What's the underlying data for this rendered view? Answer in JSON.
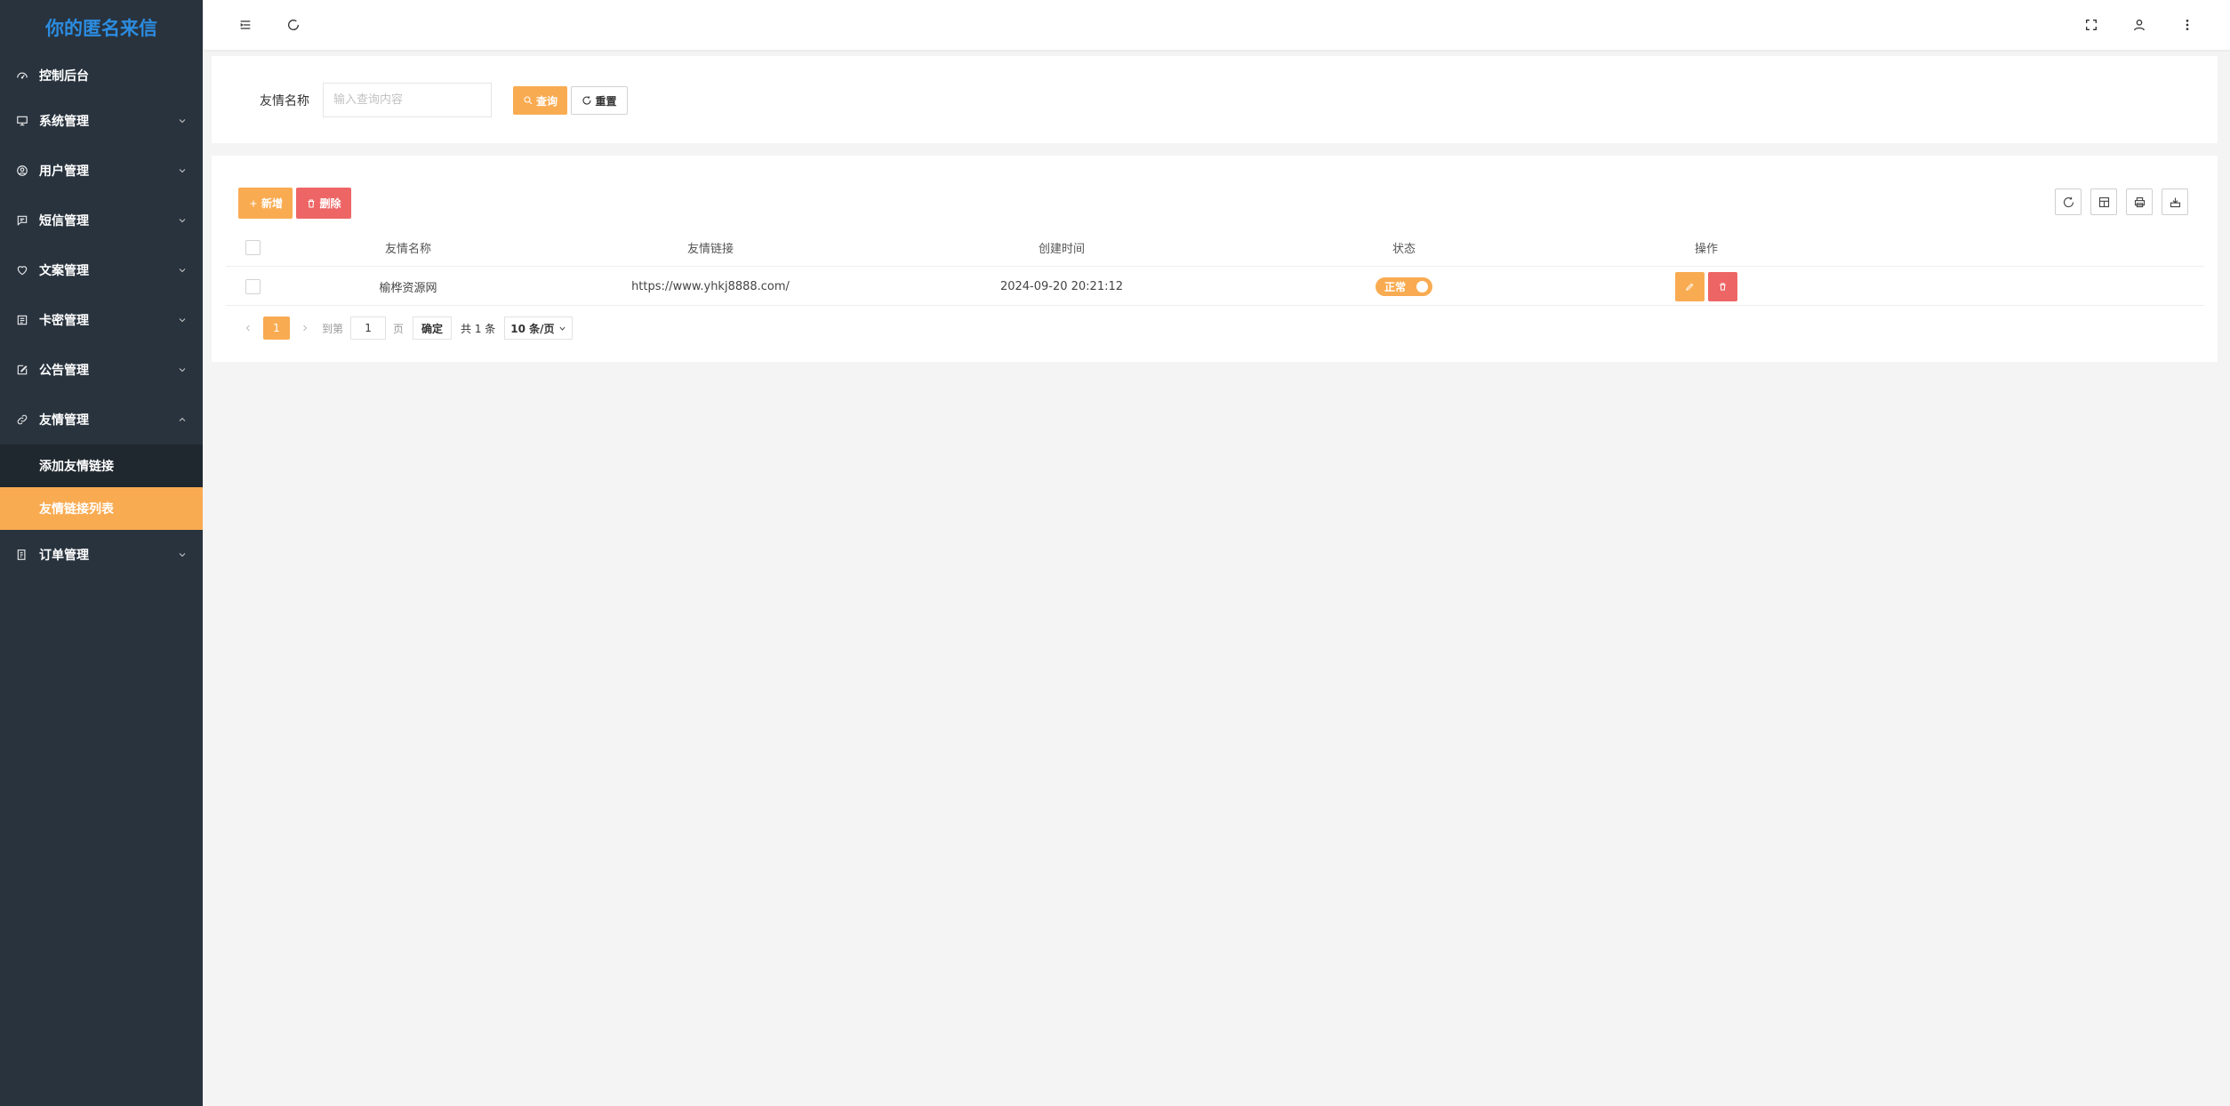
{
  "brand": {
    "title": "你的匿名来信"
  },
  "sidebar": {
    "items": [
      {
        "label": "控制后台",
        "icon": "dashboard-icon"
      },
      {
        "label": "系统管理",
        "icon": "monitor-icon"
      },
      {
        "label": "用户管理",
        "icon": "user-circle-icon"
      },
      {
        "label": "短信管理",
        "icon": "message-icon"
      },
      {
        "label": "文案管理",
        "icon": "heart-icon"
      },
      {
        "label": "卡密管理",
        "icon": "list-icon"
      },
      {
        "label": "公告管理",
        "icon": "edit-icon"
      },
      {
        "label": "友情管理",
        "icon": "link-icon"
      },
      {
        "label": "订单管理",
        "icon": "order-icon"
      }
    ],
    "sub_items": [
      {
        "label": "添加友情链接"
      },
      {
        "label": "友情链接列表"
      }
    ]
  },
  "search": {
    "label": "友情名称",
    "placeholder": "输入查询内容",
    "query_label": "查询",
    "reset_label": "重置"
  },
  "toolbar": {
    "add_label": "新增",
    "delete_label": "删除"
  },
  "table": {
    "columns": [
      "友情名称",
      "友情链接",
      "创建时间",
      "状态",
      "操作"
    ],
    "rows": [
      {
        "name": "榆桦资源网",
        "link": "https://www.yhkj8888.com/",
        "created": "2024-09-20 20:21:12",
        "status": "正常"
      }
    ]
  },
  "pagination": {
    "current_page": "1",
    "goto_prefix": "到第",
    "goto_value": "1",
    "goto_suffix": "页",
    "confirm_label": "确定",
    "total": "共 1 条",
    "page_size": "10 条/页"
  },
  "colors": {
    "accent": "#f9ab51",
    "danger": "#ee6565",
    "sidebar_bg": "#28333e",
    "brand_blue": "#2c8ce0"
  }
}
